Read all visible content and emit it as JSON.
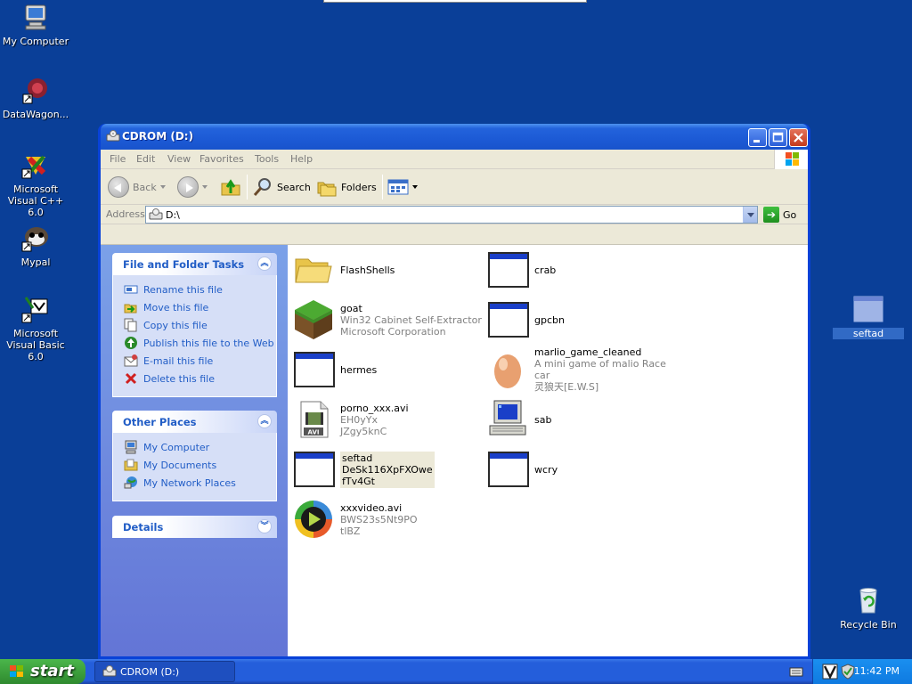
{
  "desktop": {
    "icons": [
      {
        "label": "My Computer"
      },
      {
        "label": "DataWagon..."
      },
      {
        "label": "Microsoft Visual C++ 6.0"
      },
      {
        "label": "Mypal"
      },
      {
        "label": "Microsoft Visual Basic 6.0"
      },
      {
        "label": "seftad"
      },
      {
        "label": "Recycle Bin"
      }
    ]
  },
  "window": {
    "title": "CDROM (D:)",
    "menu": [
      "File",
      "Edit",
      "View",
      "Favorites",
      "Tools",
      "Help"
    ],
    "toolbar": {
      "back": "Back",
      "search": "Search",
      "folders": "Folders"
    },
    "address": {
      "label": "Address",
      "value": "D:\\",
      "go": "Go"
    }
  },
  "tasks": {
    "file_folder": {
      "title": "File and Folder Tasks",
      "items": [
        "Rename this file",
        "Move this file",
        "Copy this file",
        "Publish this file to the Web",
        "E-mail this file",
        "Delete this file"
      ]
    },
    "other_places": {
      "title": "Other Places",
      "items": [
        "My Computer",
        "My Documents",
        "My Network Places"
      ]
    },
    "details": {
      "title": "Details"
    }
  },
  "files": [
    {
      "name": "FlashShells",
      "lines": []
    },
    {
      "name": "crab",
      "lines": []
    },
    {
      "name": "goat",
      "lines": [
        "Win32 Cabinet Self-Extractor",
        "Microsoft Corporation"
      ]
    },
    {
      "name": "gpcbn",
      "lines": []
    },
    {
      "name": "hermes",
      "lines": []
    },
    {
      "name": "marlio_game_cleaned",
      "lines": [
        "A mini game of malio Race car",
        "灵狼天[E.W.S]"
      ]
    },
    {
      "name": "porno_xxx.avi",
      "lines": [
        "EH0yYx",
        "JZgy5knC"
      ]
    },
    {
      "name": "sab",
      "lines": []
    },
    {
      "name": "seftad",
      "lines": [
        "DeSk116XpFXOwe",
        "fTv4Gt"
      ]
    },
    {
      "name": "wcry",
      "lines": []
    },
    {
      "name": "xxxvideo.avi",
      "lines": [
        "BWS23s5Nt9PO",
        "tlBZ"
      ]
    }
  ],
  "taskbar": {
    "start": "start",
    "window_button": "CDROM (D:)",
    "clock": "11:42 PM"
  },
  "colors": {
    "desktop": "#0a3f98",
    "titlebar": "#1c5ad5",
    "link": "#215dc6",
    "start": "#2f8a2f"
  }
}
